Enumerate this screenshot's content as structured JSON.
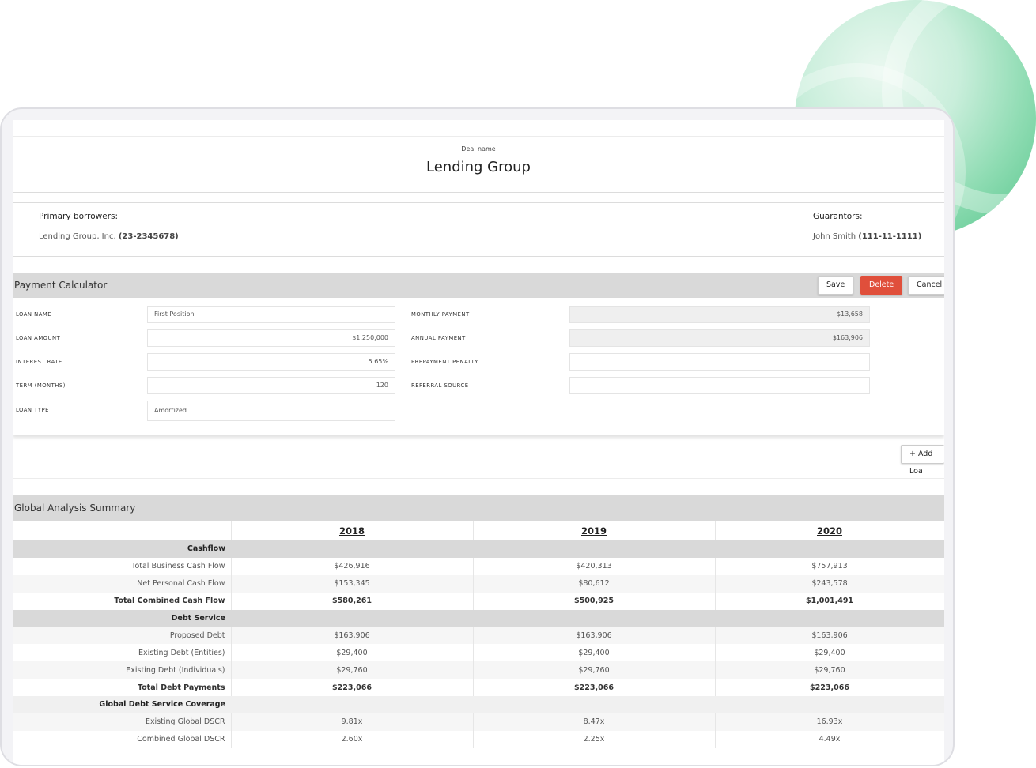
{
  "deal": {
    "label": "Deal name",
    "name": "Lending Group"
  },
  "borrowers": {
    "primary_label": "Primary borrowers:",
    "primary_name": "Lending Group, Inc.",
    "primary_id": "(23-2345678)",
    "guarantors_label": "Guarantors:",
    "guarantor_name": "John Smith",
    "guarantor_id": "(111-11-1111)"
  },
  "calculator": {
    "title": "Payment Calculator",
    "save_label": "Save",
    "delete_label": "Delete",
    "cancel_label": "Cancel",
    "loan_name": {
      "label": "LOAN NAME",
      "value": "First Position"
    },
    "loan_amount": {
      "label": "LOAN AMOUNT",
      "value": "$1,250,000"
    },
    "interest_rate": {
      "label": "INTEREST RATE",
      "value": "5.65%"
    },
    "term": {
      "label": "TERM (MONTHS)",
      "value": "120"
    },
    "loan_type": {
      "label": "LOAN TYPE",
      "value": "Amortized"
    },
    "monthly_payment": {
      "label": "MONTHLY PAYMENT",
      "value": "$13,658"
    },
    "annual_payment": {
      "label": "ANNUAL PAYMENT",
      "value": "$163,906"
    },
    "prepayment_penalty": {
      "label": "PREPAYMENT PENALTY",
      "value": ""
    },
    "referral_source": {
      "label": "REFERRAL SOURCE",
      "value": ""
    },
    "add_loan_label": "+ Add Loa"
  },
  "summary": {
    "title": "Global Analysis Summary",
    "years": [
      "2018",
      "2019",
      "2020"
    ],
    "groups": {
      "cashflow": "Cashflow",
      "debt_service": "Debt Service",
      "coverage": "Global Debt Service Coverage"
    },
    "rows": {
      "total_business": {
        "label": "Total Business Cash Flow",
        "values": [
          "$426,916",
          "$420,313",
          "$757,913"
        ]
      },
      "net_personal": {
        "label": "Net Personal Cash Flow",
        "values": [
          "$153,345",
          "$80,612",
          "$243,578"
        ]
      },
      "total_combined": {
        "label": "Total Combined Cash Flow",
        "values": [
          "$580,261",
          "$500,925",
          "$1,001,491"
        ]
      },
      "proposed_debt": {
        "label": "Proposed Debt",
        "values": [
          "$163,906",
          "$163,906",
          "$163,906"
        ]
      },
      "existing_entities": {
        "label": "Existing Debt (Entities)",
        "values": [
          "$29,400",
          "$29,400",
          "$29,400"
        ]
      },
      "existing_individuals": {
        "label": "Existing Debt (Individuals)",
        "values": [
          "$29,760",
          "$29,760",
          "$29,760"
        ]
      },
      "total_debt": {
        "label": "Total Debt Payments",
        "values": [
          "$223,066",
          "$223,066",
          "$223,066"
        ]
      },
      "existing_dscr": {
        "label": "Existing Global DSCR",
        "values": [
          "9.81x",
          "8.47x",
          "16.93x"
        ]
      },
      "combined_dscr": {
        "label": "Combined Global DSCR",
        "values": [
          "2.60x",
          "2.25x",
          "4.49x"
        ]
      }
    }
  },
  "colors": {
    "delete": "#e04f3b",
    "section_bar": "#d9d9d9",
    "accent_green": "#52c489"
  }
}
